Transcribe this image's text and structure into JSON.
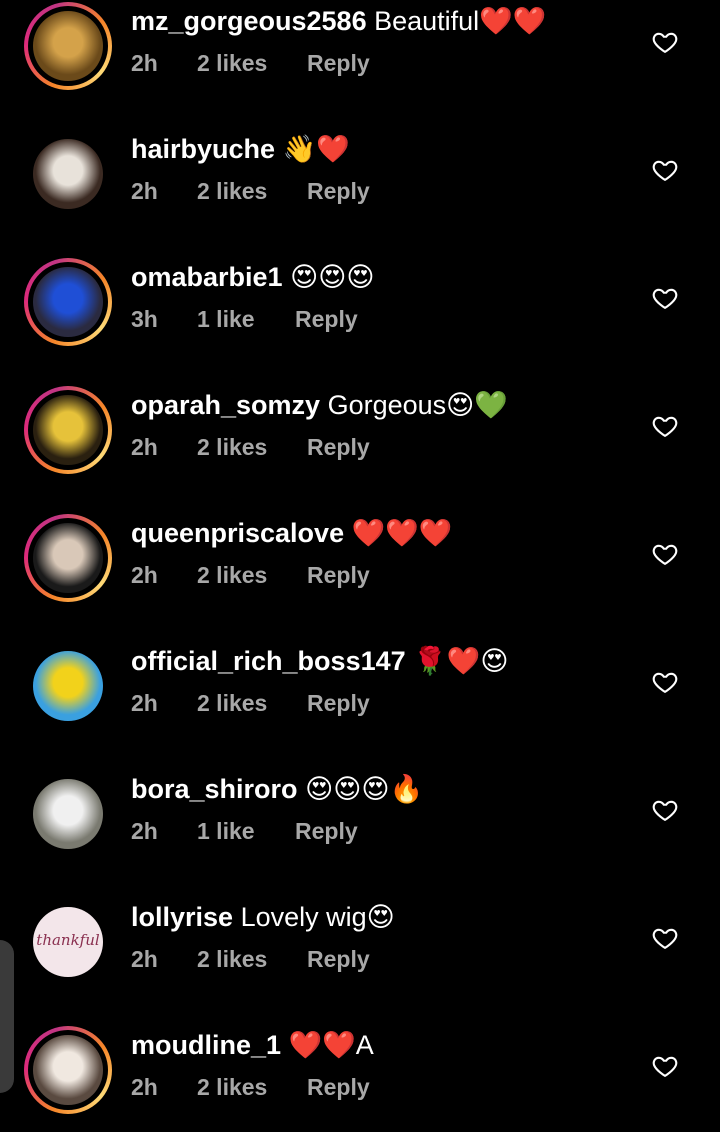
{
  "comments": [
    {
      "username": "mz_gorgeous2586",
      "text": "Beautiful",
      "emojis": "❤️❤️",
      "time": "2h",
      "likes": "2 likes",
      "reply": "Reply",
      "ring": true,
      "avatar_colors": [
        "#6b4a1a",
        "#d4a24a"
      ]
    },
    {
      "username": "hairbyuche",
      "text": "",
      "emojis": "👋❤️",
      "time": "2h",
      "likes": "2 likes",
      "reply": "Reply",
      "ring": false,
      "avatar_colors": [
        "#3b2a22",
        "#e8e2da"
      ]
    },
    {
      "username": "omabarbie1",
      "text": "",
      "emojis": "😍😍😍",
      "time": "3h",
      "likes": "1 like",
      "reply": "Reply",
      "ring": true,
      "avatar_colors": [
        "#2a2a40",
        "#1f4fd6"
      ]
    },
    {
      "username": "oparah_somzy",
      "text": "Gorgeous",
      "emojis": "😍💚",
      "time": "2h",
      "likes": "2 likes",
      "reply": "Reply",
      "ring": true,
      "avatar_colors": [
        "#2a2010",
        "#e6c23a"
      ]
    },
    {
      "username": "queenpriscalove",
      "text": "",
      "emojis": "❤️❤️❤️",
      "time": "2h",
      "likes": "2 likes",
      "reply": "Reply",
      "ring": true,
      "avatar_colors": [
        "#1a1a1a",
        "#d9c8b8"
      ]
    },
    {
      "username": "official_rich_boss147",
      "text": "",
      "emojis": "🌹❤️😍",
      "time": "2h",
      "likes": "2 likes",
      "reply": "Reply",
      "ring": false,
      "avatar_colors": [
        "#3aa0e0",
        "#f2d21b"
      ]
    },
    {
      "username": "bora_shiroro",
      "text": "",
      "emojis": "😍😍😍🔥",
      "time": "2h",
      "likes": "1 like",
      "reply": "Reply",
      "ring": false,
      "avatar_colors": [
        "#7a7a70",
        "#f0f0f0"
      ]
    },
    {
      "username": "lollyrise",
      "text": "Lovely wig",
      "emojis": "😍",
      "time": "2h",
      "likes": "2 likes",
      "reply": "Reply",
      "ring": false,
      "avatar_colors": [
        "#f3e6ea",
        "#8a3050"
      ],
      "avatar_text": "thankful"
    },
    {
      "username": "moudline_1",
      "text": "",
      "emojis": "❤️❤️A",
      "time": "2h",
      "likes": "2 likes",
      "reply": "Reply",
      "ring": true,
      "avatar_colors": [
        "#5a4a40",
        "#f0e8e0"
      ]
    }
  ],
  "icons": {
    "like": "heart-outline-icon"
  },
  "colors": {
    "background": "#000000",
    "meta": "#a8a8a8",
    "heart": "#e0245e",
    "ring_start": "#f58529",
    "ring_end": "#dd2a7b"
  }
}
